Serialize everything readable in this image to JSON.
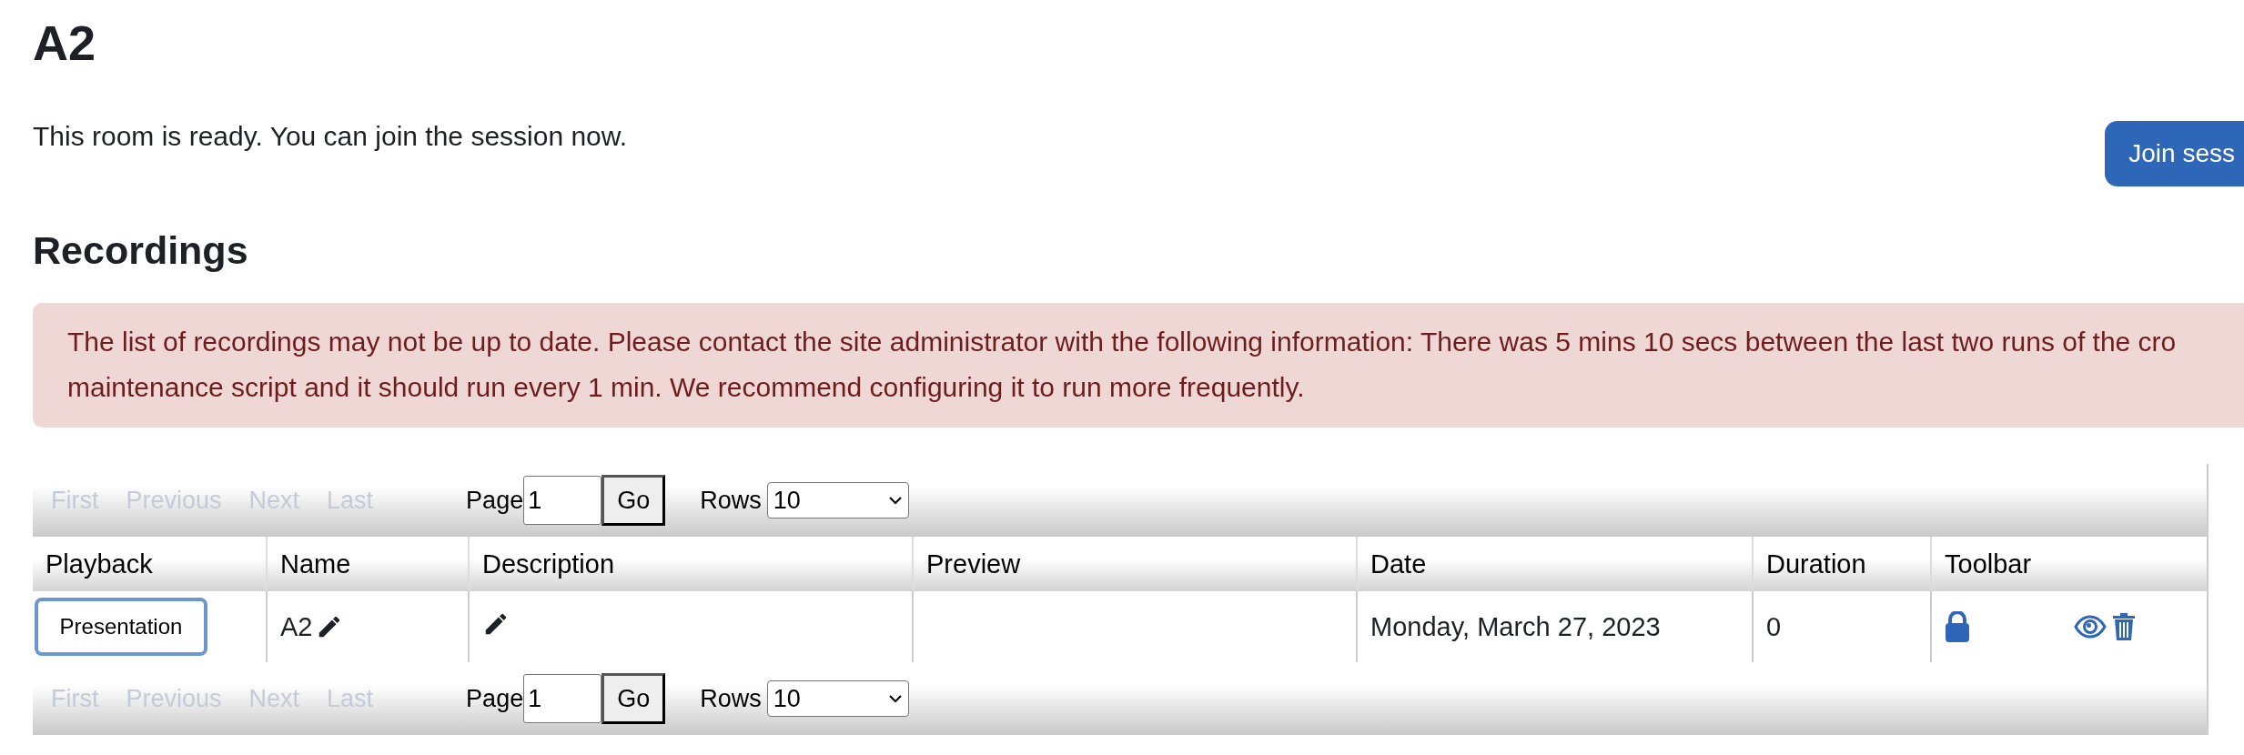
{
  "title": "A2",
  "status_message": "This room is ready. You can join the session now.",
  "join_button": "Join sess",
  "recordings_heading": "Recordings",
  "alert": {
    "lines": [
      "The list of recordings may not be up to date. Please contact the site administrator with the following information: There was 5 mins 10 secs between the last two runs of the cro",
      "maintenance script and it should run every 1 min. We recommend configuring it to run more frequently."
    ]
  },
  "pagers": [
    {
      "links": [
        {
          "label": "First",
          "disabled": true
        },
        {
          "label": "Previous",
          "disabled": true
        },
        {
          "label": "Next",
          "disabled": true
        },
        {
          "label": "Last",
          "disabled": true
        }
      ],
      "page_label": "Page",
      "page_value": "1",
      "go_button": "Go",
      "rows_label": "Rows",
      "rows_value": "10"
    },
    {
      "links": [
        {
          "label": "First",
          "disabled": true
        },
        {
          "label": "Previous",
          "disabled": true
        },
        {
          "label": "Next",
          "disabled": true
        },
        {
          "label": "Last",
          "disabled": true
        }
      ],
      "page_label": "Page",
      "page_value": "1",
      "go_button": "Go",
      "rows_label": "Rows",
      "rows_value": "10"
    }
  ],
  "table": {
    "columns": [
      "Playback",
      "Name",
      "Description",
      "Preview",
      "Date",
      "Duration",
      "Toolbar"
    ],
    "rows": [
      {
        "playback": "Presentation",
        "name": "A2",
        "date": "Monday, March 27, 2023",
        "duration": "0"
      }
    ]
  }
}
